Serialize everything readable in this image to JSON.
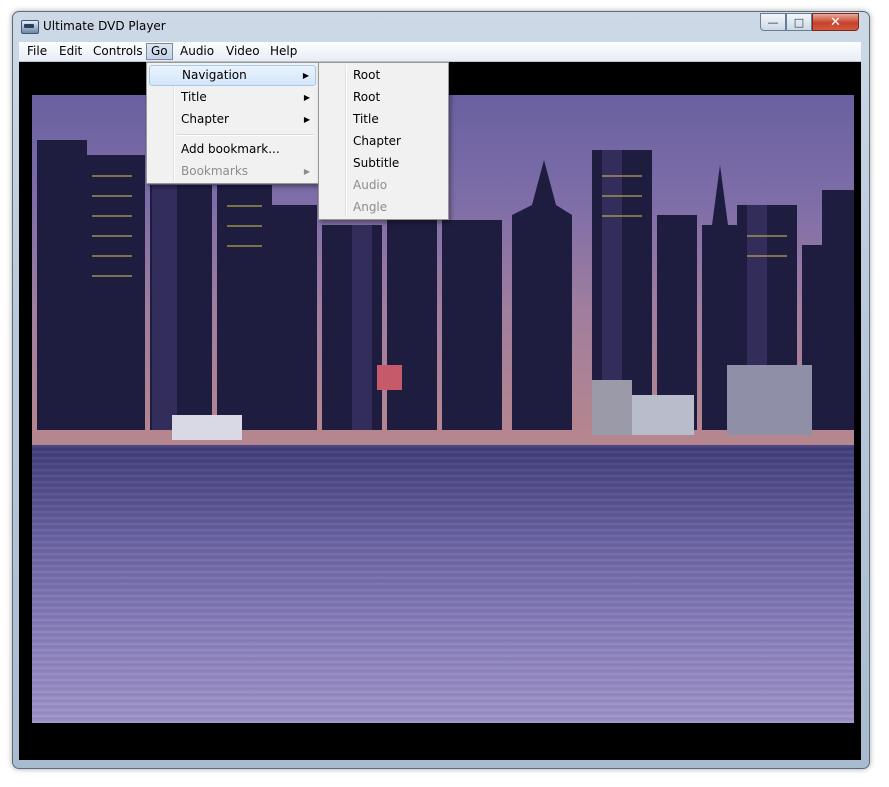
{
  "window": {
    "title": "Ultimate DVD Player"
  },
  "menubar": {
    "items": [
      {
        "label": "File"
      },
      {
        "label": "Edit"
      },
      {
        "label": "Controls"
      },
      {
        "label": "Go"
      },
      {
        "label": "Audio"
      },
      {
        "label": "Video"
      },
      {
        "label": "Help"
      }
    ],
    "active": "Go"
  },
  "go_menu": {
    "items": [
      {
        "label": "Navigation",
        "submenu": true,
        "highlighted": true
      },
      {
        "label": "Title",
        "submenu": true
      },
      {
        "label": "Chapter",
        "submenu": true
      },
      {
        "label": "Add bookmark..."
      },
      {
        "label": "Bookmarks",
        "submenu": true,
        "disabled": true
      }
    ]
  },
  "navigation_submenu": {
    "items": [
      {
        "label": "Root"
      },
      {
        "label": "Root"
      },
      {
        "label": "Title"
      },
      {
        "label": "Chapter"
      },
      {
        "label": "Subtitle"
      },
      {
        "label": "Audio",
        "disabled": true
      },
      {
        "label": "Angle",
        "disabled": true
      }
    ]
  },
  "icons": {
    "app": "dvd-player-icon",
    "submenu_arrow": "submenu-arrow-icon",
    "minimize": "minimize-icon",
    "maximize": "maximize-icon",
    "close": "close-icon"
  },
  "colors": {
    "menu_highlight": "#d3e6fa",
    "close_button": "#c7432b",
    "video_background": "#000000"
  }
}
